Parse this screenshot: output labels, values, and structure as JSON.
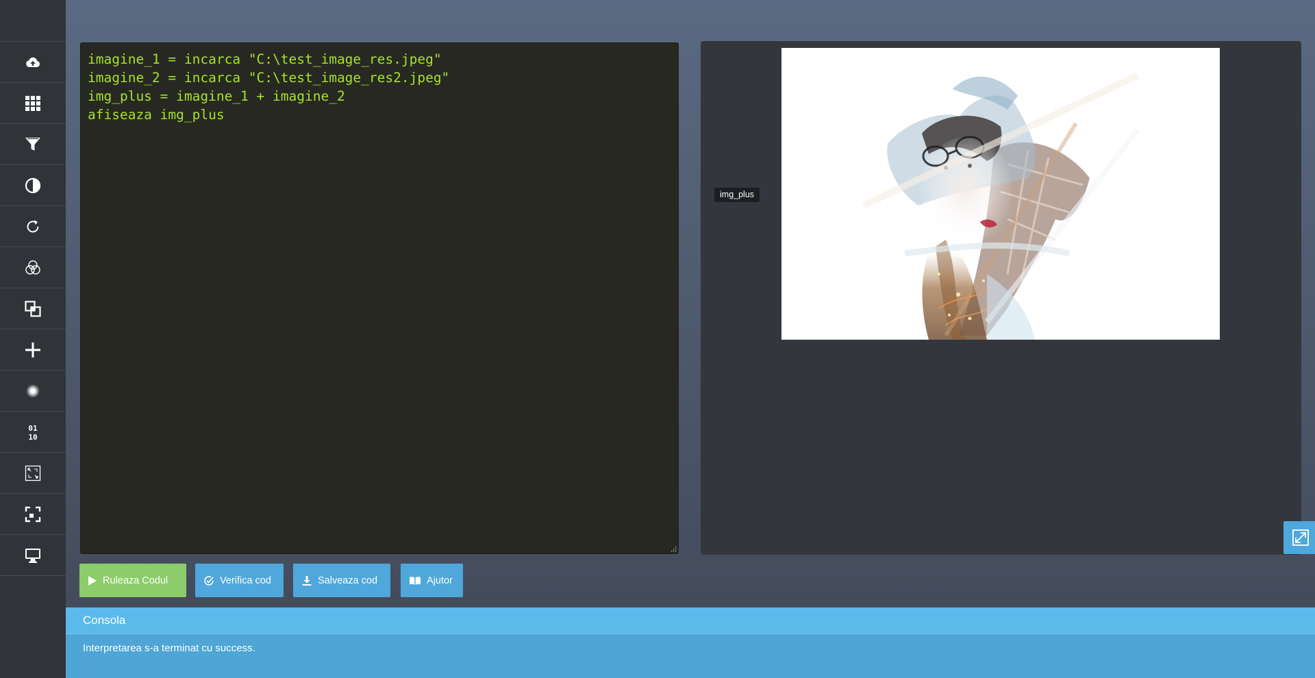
{
  "sidebar": {
    "items": [
      {
        "icon": "cloud-upload-icon"
      },
      {
        "icon": "grid-icon"
      },
      {
        "icon": "filter-icon"
      },
      {
        "icon": "contrast-icon"
      },
      {
        "icon": "rotate-icon"
      },
      {
        "icon": "color-channels-icon"
      },
      {
        "icon": "overlay-icon"
      },
      {
        "icon": "plus-icon"
      },
      {
        "icon": "blur-icon"
      },
      {
        "icon": "binary-icon"
      },
      {
        "icon": "resize-icon"
      },
      {
        "icon": "crop-icon"
      },
      {
        "icon": "monitor-icon"
      }
    ]
  },
  "editor": {
    "lines": [
      "imagine_1 = incarca \"C:\\test_image_res.jpeg\"",
      "imagine_2 = incarca \"C:\\test_image_res2.jpeg\"",
      "img_plus = imagine_1 + imagine_2",
      "afiseaza img_plus"
    ]
  },
  "output": {
    "image_label": "img_plus"
  },
  "toolbar": {
    "run_label": "Ruleaza Codul",
    "verify_label": "Verifica cod",
    "save_label": "Salveaza cod",
    "help_label": "Ajutor"
  },
  "console": {
    "title": "Consola",
    "message": "Interpretarea s-a terminat cu success."
  },
  "colors": {
    "code_text": "#a6e22e",
    "run_button": "#8ccc6a",
    "action_button": "#4fa7db",
    "console_header": "#5bb9ec",
    "console_body": "#4ea5d6"
  }
}
